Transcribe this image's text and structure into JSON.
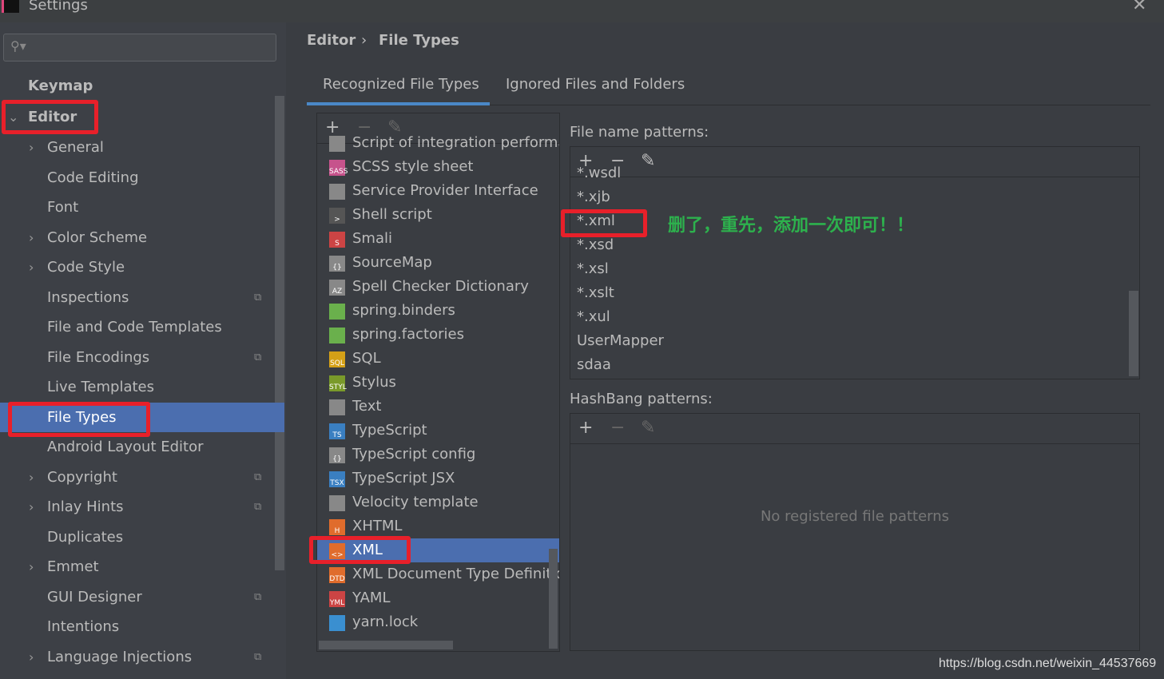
{
  "window": {
    "title": "Settings"
  },
  "search": {
    "placeholder": ""
  },
  "sidebar": {
    "items": [
      {
        "label": "Keymap",
        "level": 0
      },
      {
        "label": "Editor",
        "level": 0,
        "expanded": true
      },
      {
        "label": "General",
        "chevron": true
      },
      {
        "label": "Code Editing"
      },
      {
        "label": "Font"
      },
      {
        "label": "Color Scheme",
        "chevron": true
      },
      {
        "label": "Code Style",
        "chevron": true
      },
      {
        "label": "Inspections",
        "copy": true
      },
      {
        "label": "File and Code Templates"
      },
      {
        "label": "File Encodings",
        "copy": true
      },
      {
        "label": "Live Templates"
      },
      {
        "label": "File Types",
        "selected": true
      },
      {
        "label": "Android Layout Editor"
      },
      {
        "label": "Copyright",
        "chevron": true,
        "copy": true
      },
      {
        "label": "Inlay Hints",
        "chevron": true,
        "copy": true
      },
      {
        "label": "Duplicates"
      },
      {
        "label": "Emmet",
        "chevron": true
      },
      {
        "label": "GUI Designer",
        "copy": true
      },
      {
        "label": "Intentions"
      },
      {
        "label": "Language Injections",
        "chevron": true,
        "copy": true
      }
    ]
  },
  "breadcrumb": {
    "parent": "Editor",
    "sep": "›",
    "current": "File Types"
  },
  "tabs": [
    {
      "label": "Recognized File Types",
      "active": true
    },
    {
      "label": "Ignored Files and Folders"
    }
  ],
  "file_types": [
    {
      "label": "Script of integration performa",
      "icon": ""
    },
    {
      "label": "SCSS style sheet",
      "icon": "SASS",
      "color": "#c6538c"
    },
    {
      "label": "Service Provider Interface",
      "icon": "",
      "color": "#888"
    },
    {
      "label": "Shell script",
      "icon": ">",
      "color": "#555"
    },
    {
      "label": "Smali",
      "icon": "S",
      "color": "#c44"
    },
    {
      "label": "SourceMap",
      "icon": "{}",
      "color": "#888"
    },
    {
      "label": "Spell Checker Dictionary",
      "icon": "AZ",
      "color": "#888"
    },
    {
      "label": "spring.binders",
      "icon": "",
      "color": "#6ab04c"
    },
    {
      "label": "spring.factories",
      "icon": "",
      "color": "#6ab04c"
    },
    {
      "label": "SQL",
      "icon": "SQL",
      "color": "#d4a017"
    },
    {
      "label": "Stylus",
      "icon": "STYL",
      "color": "#7a9a2a"
    },
    {
      "label": "Text",
      "icon": "",
      "color": "#888"
    },
    {
      "label": "TypeScript",
      "icon": "TS",
      "color": "#3a7fc1"
    },
    {
      "label": "TypeScript config",
      "icon": "{}",
      "color": "#888"
    },
    {
      "label": "TypeScript JSX",
      "icon": "TSX",
      "color": "#3a7fc1"
    },
    {
      "label": "Velocity template",
      "icon": "",
      "color": "#888"
    },
    {
      "label": "XHTML",
      "icon": "H",
      "color": "#e06c2c"
    },
    {
      "label": "XML",
      "icon": "<>",
      "color": "#e06c2c",
      "selected": true
    },
    {
      "label": "XML Document Type Definitio",
      "icon": "DTD",
      "color": "#e06c2c"
    },
    {
      "label": "YAML",
      "icon": "YML",
      "color": "#c44"
    },
    {
      "label": "yarn.lock",
      "icon": "",
      "color": "#3a8fd0"
    }
  ],
  "patterns": {
    "label": "File name patterns:",
    "items": [
      "*.wsdl",
      "*.xjb",
      "*.xml",
      "*.xsd",
      "*.xsl",
      "*.xslt",
      "*.xul",
      "UserMapper",
      "sdaa"
    ]
  },
  "annotation": "删了，重先，添加一次即可！！",
  "hashbang": {
    "label": "HashBang patterns:",
    "empty": "No registered file patterns"
  },
  "toolbar": {
    "add": "+",
    "remove": "−",
    "edit": "✎"
  },
  "watermark": "https://blog.csdn.net/weixin_44537669",
  "colors": {
    "selection": "#4b6eaf",
    "highlight": "#e8202a",
    "annotation": "#2db14d"
  }
}
